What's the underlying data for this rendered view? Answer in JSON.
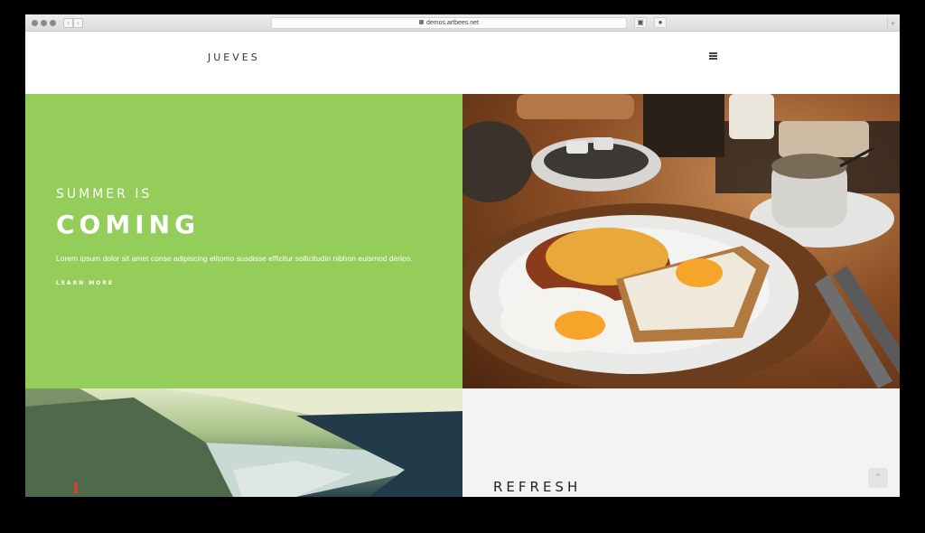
{
  "browser": {
    "url": "demos.artbees.net",
    "plus_label": "+"
  },
  "header": {
    "logo": "JUEVES",
    "menu_icon": "hamburger-icon"
  },
  "hero": {
    "eyebrow": "SUMMER IS",
    "headline": "COMING",
    "description": "Lorem ipsum dolor sit amet conse adipiscing elitomo susdisse efficitur sollicitudin nibhon euismod derico.",
    "cta": "LEARN MORE"
  },
  "section2": {
    "title": "REFRESH"
  },
  "colors": {
    "hero_green": "#95cd5a",
    "page_bg": "#ffffff",
    "panel_gray": "#f3f3f3"
  }
}
